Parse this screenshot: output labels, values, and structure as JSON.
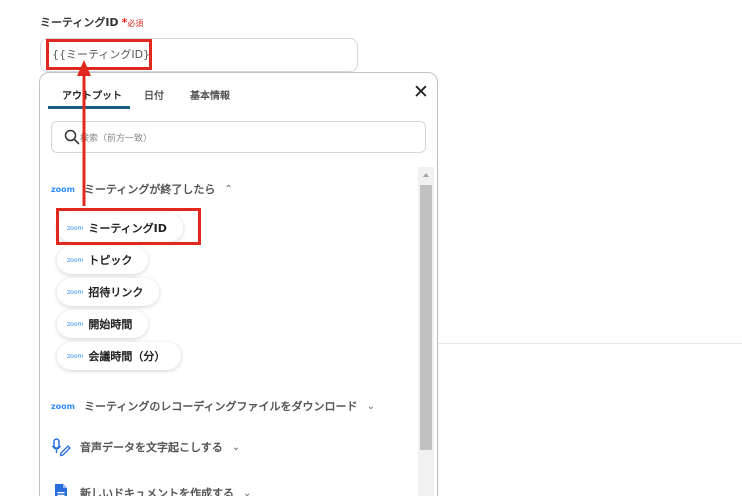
{
  "field": {
    "label": "ミーティングID",
    "required_star": "*",
    "required_text": "必須",
    "value": "{{ミーティングID}}"
  },
  "panel": {
    "tabs": [
      {
        "label": "アウトプット",
        "active": true
      },
      {
        "label": "日付",
        "active": false
      },
      {
        "label": "基本情報",
        "active": false
      }
    ],
    "close_label": "✕",
    "search": {
      "placeholder": "検索（前方一致）"
    },
    "sections": [
      {
        "icon": "zoom-logo",
        "logo_text": "zoom",
        "label": "ミーティングが終了したら",
        "caret": "⌃"
      },
      {
        "icon": "zoom-logo",
        "logo_text": "zoom",
        "label": "ミーティングのレコーディングファイルをダウンロード",
        "caret": "⌄"
      },
      {
        "icon": "voice-transcription-icon",
        "label": "音声データを文字起こしする",
        "caret": "⌄"
      },
      {
        "icon": "document-icon",
        "label": "新しいドキュメントを作成する",
        "caret": "⌄"
      }
    ],
    "items": [
      {
        "logo_text": "zoom",
        "label": "ミーティングID"
      },
      {
        "logo_text": "zoom",
        "label": "トピック"
      },
      {
        "logo_text": "zoom",
        "label": "招待リンク"
      },
      {
        "logo_text": "zoom",
        "label": "開始時間"
      },
      {
        "logo_text": "zoom",
        "label": "会議時間（分）"
      }
    ]
  },
  "colors": {
    "annotation_red": "#e0281e",
    "tab_underline": "#175e87",
    "zoom_blue": "#2d8cff",
    "doc_blue": "#2a6fdb"
  }
}
